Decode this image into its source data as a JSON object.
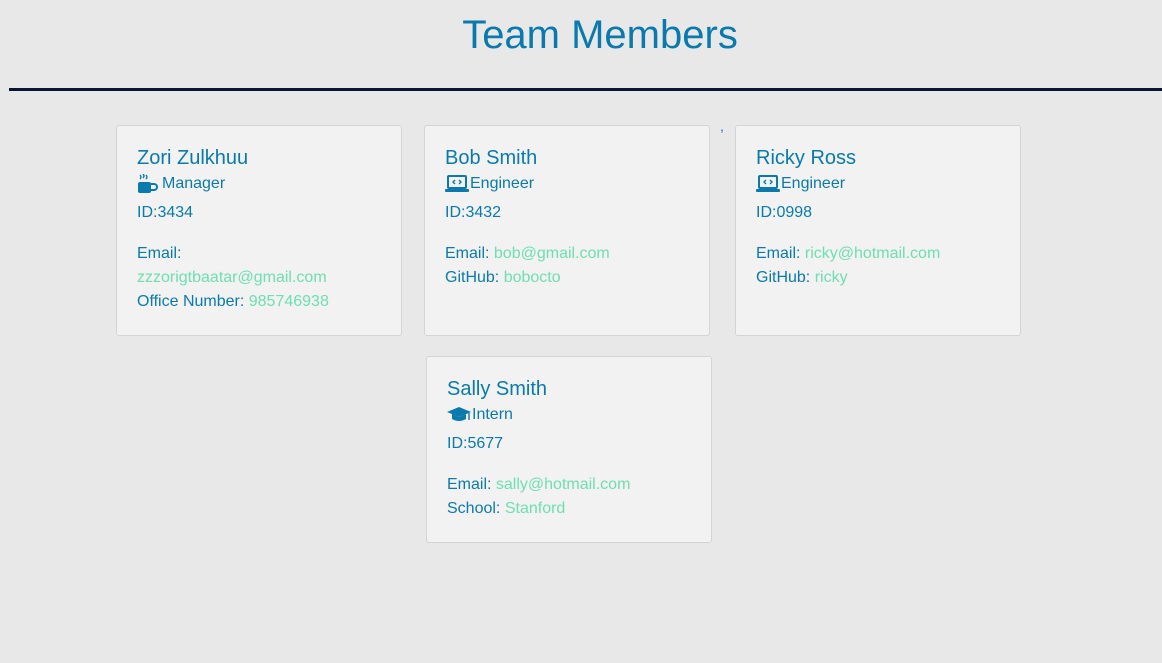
{
  "page": {
    "title": "Team Members",
    "stray_mark": ","
  },
  "colors": {
    "primary": "#0a7aae",
    "value": "#6ddfb1",
    "divider": "#0b1433",
    "background": "#e8e8e8",
    "card": "#f2f2f2"
  },
  "members": [
    {
      "name": "Zori Zulkhuu",
      "role": "Manager",
      "icon": "coffee-mug-icon",
      "id_label": "ID:3434",
      "email_label": "Email:",
      "email": "zzzorigtbaatar@gmail.com",
      "extra_label": "Office Number:",
      "extra_value": "985746938"
    },
    {
      "name": "Bob Smith",
      "role": "Engineer",
      "icon": "laptop-code-icon",
      "id_label": "ID:3432",
      "email_label": "Email:",
      "email": "bob@gmail.com",
      "extra_label": "GitHub:",
      "extra_value": "bobocto"
    },
    {
      "name": "Ricky Ross",
      "role": "Engineer",
      "icon": "laptop-code-icon",
      "id_label": "ID:0998",
      "email_label": "Email:",
      "email": "ricky@hotmail.com",
      "extra_label": "GitHub:",
      "extra_value": "ricky"
    },
    {
      "name": "Sally Smith",
      "role": "Intern",
      "icon": "graduation-cap-icon",
      "id_label": "ID:5677",
      "email_label": "Email:",
      "email": "sally@hotmail.com",
      "extra_label": "School:",
      "extra_value": "Stanford"
    }
  ]
}
